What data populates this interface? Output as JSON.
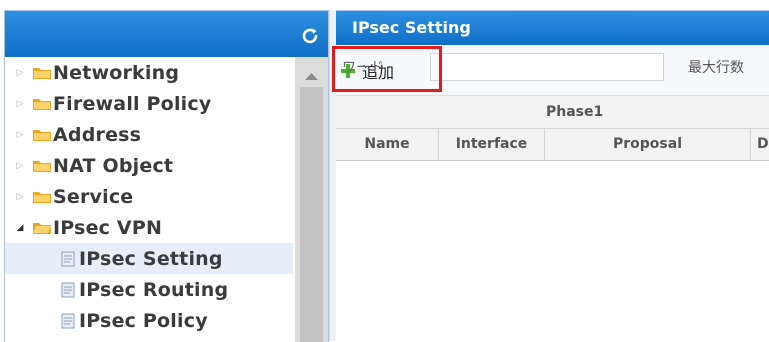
{
  "left": {
    "tree_items": [
      {
        "label": "Networking",
        "kind": "folder",
        "expanded": false
      },
      {
        "label": "Firewall Policy",
        "kind": "folder",
        "expanded": false
      },
      {
        "label": "Address",
        "kind": "folder",
        "expanded": false
      },
      {
        "label": "NAT Object",
        "kind": "folder",
        "expanded": false
      },
      {
        "label": "Service",
        "kind": "folder",
        "expanded": false
      },
      {
        "label": "IPsec VPN",
        "kind": "folder",
        "expanded": true
      },
      {
        "label": "IPsec Setting",
        "kind": "doc",
        "selected": true
      },
      {
        "label": "IPsec Routing",
        "kind": "doc"
      },
      {
        "label": "IPsec Policy",
        "kind": "doc"
      }
    ]
  },
  "right": {
    "title": "IPsec Setting",
    "toolbar": {
      "add_label": "追加",
      "search_label": "ワード",
      "max_rows_label": "最大行数"
    },
    "table": {
      "group_header": "Phase1",
      "columns": [
        "Name",
        "Interface",
        "Proposal",
        "D"
      ]
    }
  },
  "colors": {
    "header_blue": "#1a7fd6",
    "selection": "#e6eef9",
    "highlight_red": "#e31b1b",
    "folder": "#f0a31f"
  },
  "icons": [
    "refresh-icon",
    "folder-icon",
    "document-icon",
    "plus-icon",
    "scroll-up-icon"
  ]
}
